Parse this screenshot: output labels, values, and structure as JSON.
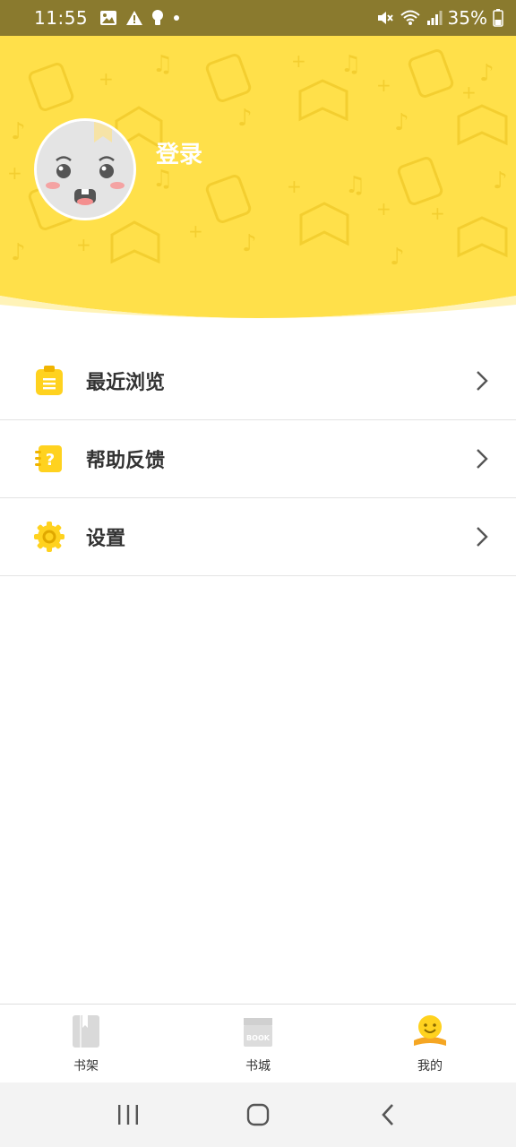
{
  "status_bar": {
    "time": "11:55",
    "battery": "35%",
    "icons_left": [
      "image-icon",
      "warning-icon",
      "bulb-icon",
      "dot-icon"
    ],
    "icons_right": [
      "mute-icon",
      "wifi-icon",
      "signal-icon",
      "battery-icon"
    ]
  },
  "profile": {
    "login_label": "登录",
    "avatar_icon": "face-avatar-icon"
  },
  "menu": {
    "items": [
      {
        "label": "最近浏览",
        "icon": "clipboard-icon"
      },
      {
        "label": "帮助反馈",
        "icon": "help-notebook-icon"
      },
      {
        "label": "设置",
        "icon": "gear-icon"
      }
    ]
  },
  "bottom_nav": {
    "items": [
      {
        "label": "书架",
        "icon": "bookshelf-icon",
        "active": false
      },
      {
        "label": "书城",
        "icon": "bookstore-icon",
        "active": false
      },
      {
        "label": "我的",
        "icon": "profile-smiley-icon",
        "active": true
      }
    ]
  },
  "colors": {
    "accent": "#FFD83A",
    "header_yellow": "#FFE04A",
    "status_bar": "#8A7A2E",
    "text": "#333333",
    "inactive_icon": "#D8D8D8"
  }
}
